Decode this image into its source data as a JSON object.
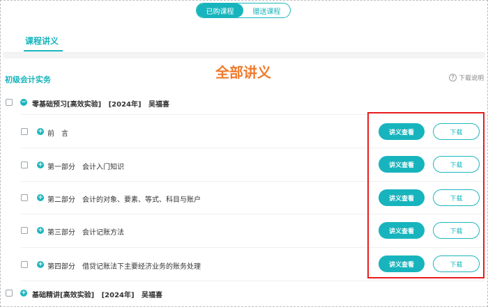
{
  "top_toggle": {
    "purchased": "已购课程",
    "gifted": "赠送课程"
  },
  "tabs": {
    "active": "课程讲义"
  },
  "annotation": "全部讲义",
  "section": {
    "title": "初级会计实务",
    "help": "下载说明",
    "help_icon": "question-icon"
  },
  "group1": {
    "expander": "−",
    "title": "零基础预习[高效实验]",
    "year": "[2024年]",
    "teacher": "吴福喜"
  },
  "chapters": [
    {
      "title": "前　言"
    },
    {
      "title": "第一部分　会计入门知识"
    },
    {
      "title": "第二部分　会计的对象、要素、等式、科目与账户"
    },
    {
      "title": "第三部分　会计记账方法"
    },
    {
      "title": "第四部分　借贷记账法下主要经济业务的账务处理"
    }
  ],
  "buttons": {
    "view": "讲义查看",
    "download": "下载"
  },
  "group2": {
    "expander": "+",
    "title": "基础精讲[高效实验]",
    "year": "[2024年]",
    "teacher": "吴福喜"
  },
  "colors": {
    "accent": "#17b4bd",
    "annotation": "#f07a2c",
    "highlight_box": "#e81b1b"
  }
}
